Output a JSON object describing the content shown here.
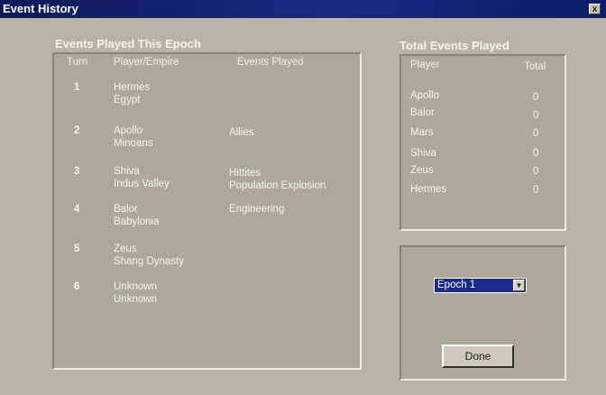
{
  "window": {
    "title": "Event History",
    "close_label": "x"
  },
  "epoch_events": {
    "heading": "Events Played This Epoch",
    "columns": {
      "turn": "Turn",
      "player": "Player/Empire",
      "events": "Events Played"
    },
    "rows": [
      {
        "turn": "1",
        "player": "Hermes",
        "empire": "Egypt",
        "events": []
      },
      {
        "turn": "2",
        "player": "Apollo",
        "empire": "Minoans",
        "events": [
          "Allies"
        ]
      },
      {
        "turn": "3",
        "player": "Shiva",
        "empire": "Indus Valley",
        "events": [
          "Hittites",
          "Population Explosion"
        ]
      },
      {
        "turn": "4",
        "player": "Balor",
        "empire": "Babylonia",
        "events": [
          "Engineering"
        ]
      },
      {
        "turn": "5",
        "player": "Zeus",
        "empire": "Shang Dynasty",
        "events": []
      },
      {
        "turn": "6",
        "player": "Unknown",
        "empire": "Unknown",
        "events": []
      }
    ]
  },
  "total_events": {
    "heading": "Total Events Played",
    "columns": {
      "player": "Player",
      "total": "Total"
    },
    "rows": [
      {
        "player": "Apollo",
        "total": "0"
      },
      {
        "player": "Balor",
        "total": "0"
      },
      {
        "player": "Mars",
        "total": "0"
      },
      {
        "player": "Shiva",
        "total": "0"
      },
      {
        "player": "Zeus",
        "total": "0"
      },
      {
        "player": "Hermes",
        "total": "0"
      }
    ]
  },
  "epoch_select": {
    "value": "Epoch 1"
  },
  "done_button": {
    "label": "Done"
  }
}
